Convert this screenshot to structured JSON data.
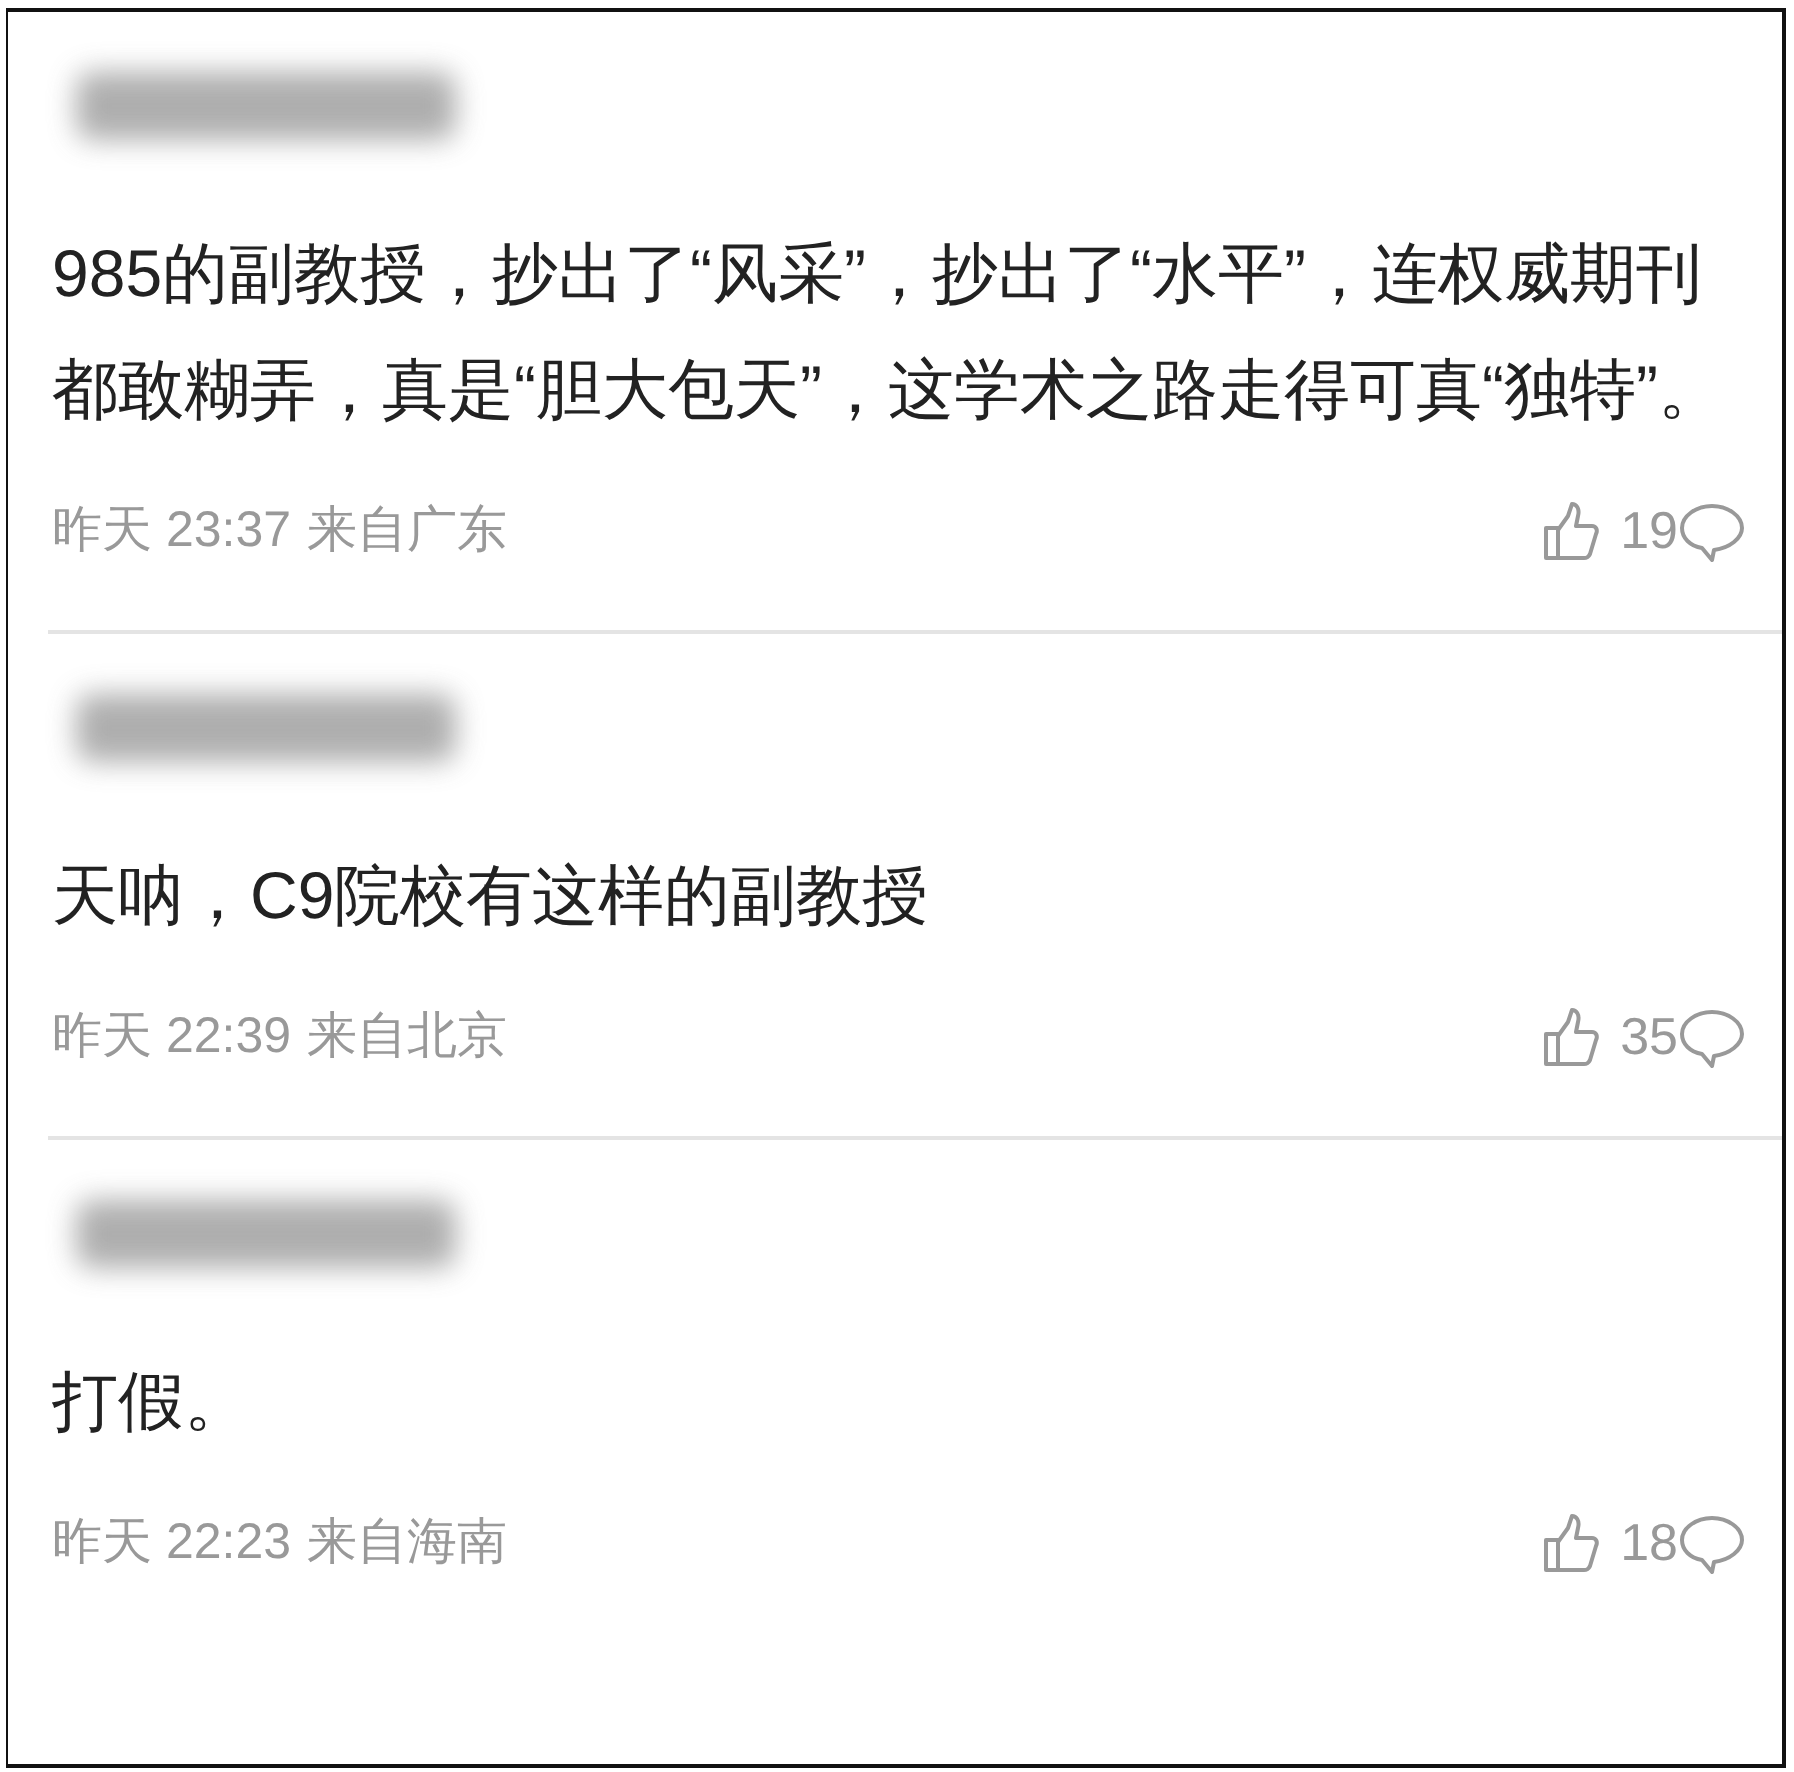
{
  "comments": [
    {
      "text": "985的副教授，抄出了“风采”，抄出了“水平”，连权威期刊都敢糊弄，真是“胆大包天”，这学术之路走得可真“独特”。",
      "time": "昨天 23:37",
      "location": "来自广东",
      "likes": "19"
    },
    {
      "text": "天呐，C9院校有这样的副教授",
      "time": "昨天 22:39",
      "location": "来自北京",
      "likes": "35"
    },
    {
      "text": "打假。",
      "time": "昨天 22:23",
      "location": "来自海南",
      "likes": "18"
    }
  ]
}
